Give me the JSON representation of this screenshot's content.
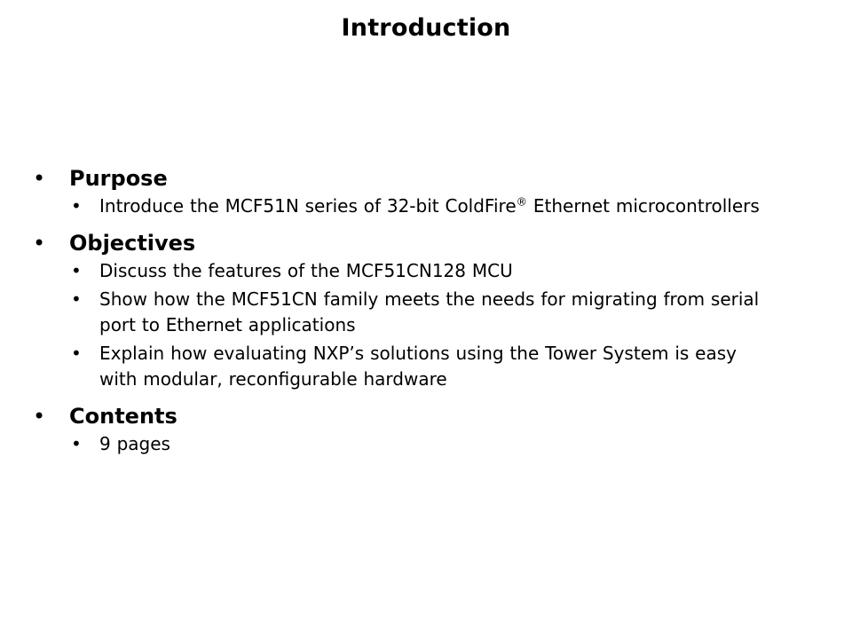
{
  "slide": {
    "title": "Introduction",
    "background_color": "#ffffff",
    "text_color": "#000000",
    "bullet_glyph_level1": "•",
    "bullet_glyph_level2": "•",
    "sections": [
      {
        "heading": "Purpose",
        "items": [
          {
            "text_before": "Introduce the MCF51N series of 32-bit ColdFire",
            "superscript": "®",
            "text_after": " Ethernet microcontrollers"
          }
        ]
      },
      {
        "heading": "Objectives",
        "items": [
          {
            "text_before": "Discuss the features of the MCF51CN128 MCU",
            "superscript": "",
            "text_after": ""
          },
          {
            "text_before": "Show how the MCF51CN family meets the needs for migrating from serial port to Ethernet applications",
            "superscript": "",
            "text_after": ""
          },
          {
            "text_before": "Explain how evaluating NXP’s solutions using the Tower System is easy with modular, reconfigurable hardware",
            "superscript": "",
            "text_after": ""
          }
        ]
      },
      {
        "heading": "Contents",
        "items": [
          {
            "text_before": "9 pages",
            "superscript": "",
            "text_after": ""
          }
        ]
      }
    ]
  }
}
